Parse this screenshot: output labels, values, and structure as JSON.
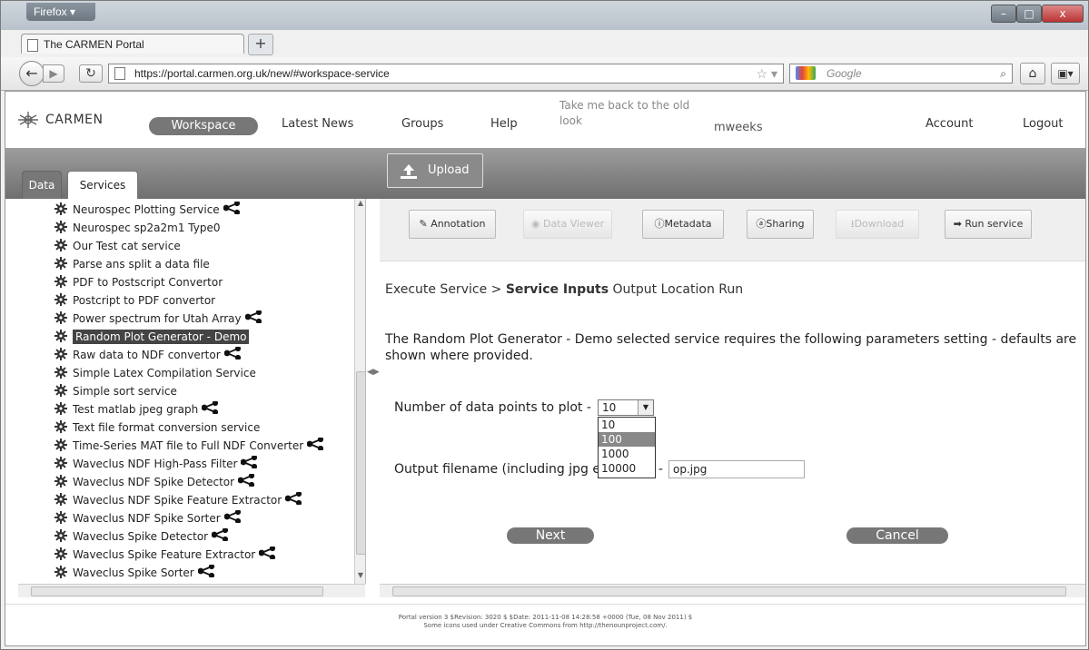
{
  "browser": {
    "menu_label": "Firefox ▾",
    "tab_title": "The CARMEN Portal",
    "new_tab": "+",
    "url": "https://portal.carmen.org.uk/new/#workspace-service",
    "search_placeholder": "Google",
    "controls": {
      "minimize": "–",
      "maximize": "□",
      "close": "x"
    }
  },
  "header": {
    "logo_text": "CARMEN",
    "nav": [
      "Workspace",
      "Latest News",
      "Groups",
      "Help"
    ],
    "old_look_link": "Take me back to the old look",
    "username": "mweeks",
    "account": "Account",
    "logout": "Logout"
  },
  "left_tabs": [
    "Data",
    "Services"
  ],
  "upload_label": "Upload",
  "services": [
    {
      "label": "Neurospec Plotting Service",
      "shared": true
    },
    {
      "label": "Neurospec sp2a2m1 Type0",
      "shared": false
    },
    {
      "label": "Our Test cat service",
      "shared": false
    },
    {
      "label": "Parse ans split a data file",
      "shared": false
    },
    {
      "label": "PDF to Postscript Convertor",
      "shared": false
    },
    {
      "label": "Postcript to PDF convertor",
      "shared": false
    },
    {
      "label": "Power spectrum for Utah Array",
      "shared": true
    },
    {
      "label": "Random Plot Generator - Demo",
      "shared": false,
      "selected": true
    },
    {
      "label": "Raw data to NDF convertor",
      "shared": true
    },
    {
      "label": "Simple Latex Compilation Service",
      "shared": false
    },
    {
      "label": "Simple sort service",
      "shared": false
    },
    {
      "label": "Test matlab jpeg graph",
      "shared": true
    },
    {
      "label": "Text file format conversion service",
      "shared": false
    },
    {
      "label": "Time-Series MAT file to Full NDF Converter",
      "shared": true
    },
    {
      "label": "Waveclus NDF High-Pass Filter",
      "shared": true
    },
    {
      "label": "Waveclus NDF Spike Detector",
      "shared": true
    },
    {
      "label": "Waveclus NDF Spike Feature Extractor",
      "shared": true
    },
    {
      "label": "Waveclus NDF Spike Sorter",
      "shared": true
    },
    {
      "label": "Waveclus Spike Detector",
      "shared": true
    },
    {
      "label": "Waveclus Spike Feature Extractor",
      "shared": true
    },
    {
      "label": "Waveclus Spike Sorter",
      "shared": true
    }
  ],
  "toolbar": {
    "annotation": "Annotation",
    "data_viewer": "Data Viewer",
    "metadata": "Metadata",
    "sharing": "Sharing",
    "download": "Download",
    "run_service": "Run service"
  },
  "breadcrumb": {
    "step1": "Execute Service > ",
    "current": "Service Inputs",
    "step3": " Output Location Run"
  },
  "description": "The Random Plot Generator - Demo selected service requires the following parameters setting - defaults are shown where provided.",
  "params": {
    "points_label": "Number of data points to plot -",
    "points_value": "10",
    "points_options": [
      "10",
      "100",
      "1000",
      "10000"
    ],
    "points_highlighted": "100",
    "filename_label_a": "Output filename (including jpg e",
    "filename_label_b": ") -",
    "filename_value": "op.jpg"
  },
  "buttons": {
    "next": "Next",
    "cancel": "Cancel"
  },
  "footer": {
    "line1": "Portal version 3 $Revision: 3020 $ $Date: 2011-11-08 14:28:58 +0000 (Tue, 08 Nov 2011) $",
    "line2": "Some icons used under Creative Commons from http://thenounproject.com/."
  }
}
